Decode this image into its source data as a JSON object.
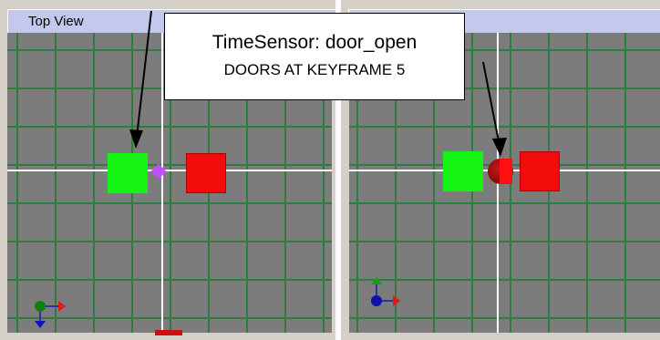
{
  "left_viewport": {
    "title": "Top View"
  },
  "callout": {
    "line1": "TimeSensor: door_open",
    "line2": "DOORS AT KEYFRAME 5"
  },
  "icons": [
    "axis-gizmo-icon"
  ],
  "colors": {
    "grid_bg": "#7c7c7c",
    "grid_line": "#2d7d3e",
    "title_bar": "#c4c8ec",
    "green_object": "#16f416",
    "red_object": "#f40c0c",
    "marker": "#c050ff"
  }
}
